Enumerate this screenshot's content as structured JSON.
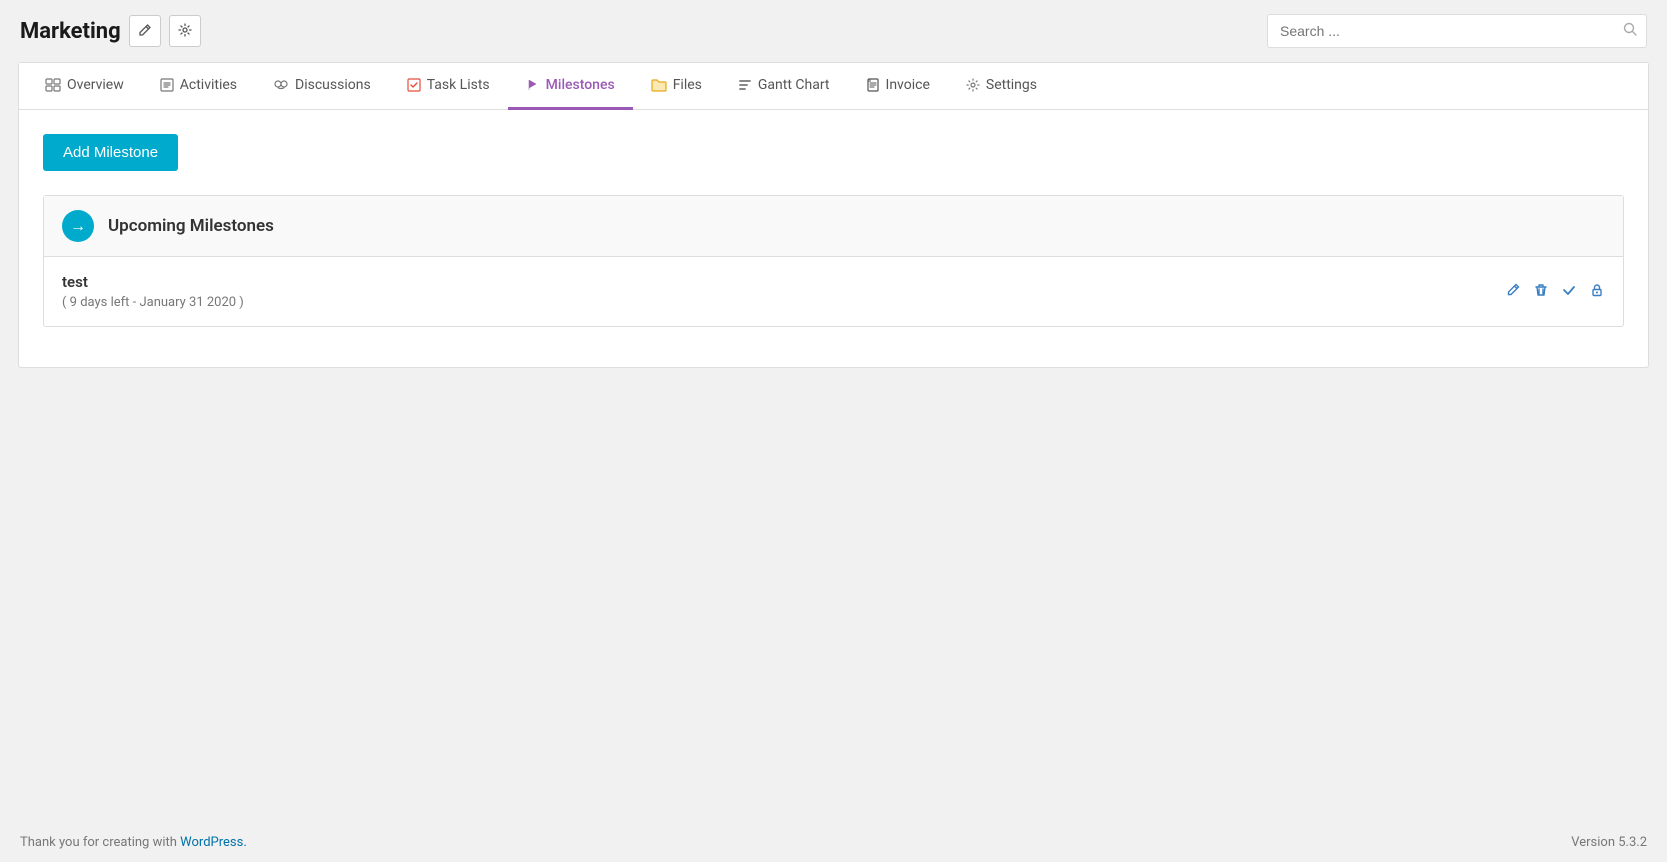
{
  "header": {
    "title": "Marketing",
    "edit_btn_label": "✏",
    "settings_btn_label": "⚙",
    "search_placeholder": "Search ..."
  },
  "tabs": [
    {
      "id": "overview",
      "label": "Overview",
      "icon": "🖥",
      "active": false
    },
    {
      "id": "activities",
      "label": "Activities",
      "icon": "📋",
      "active": false
    },
    {
      "id": "discussions",
      "label": "Discussions",
      "icon": "👥",
      "active": false
    },
    {
      "id": "task-lists",
      "label": "Task Lists",
      "icon": "✅",
      "active": false
    },
    {
      "id": "milestones",
      "label": "Milestones",
      "icon": "🚩",
      "active": true
    },
    {
      "id": "files",
      "label": "Files",
      "icon": "📁",
      "active": false
    },
    {
      "id": "gantt-chart",
      "label": "Gantt Chart",
      "icon": "≡",
      "active": false
    },
    {
      "id": "invoice",
      "label": "Invoice",
      "icon": "📄",
      "active": false
    },
    {
      "id": "settings",
      "label": "Settings",
      "icon": "⚙",
      "active": false
    }
  ],
  "add_milestone_label": "Add Milestone",
  "upcoming_milestones": {
    "section_title": "Upcoming Milestones",
    "arrow_icon": "→",
    "items": [
      {
        "name": "test",
        "date_label": "( 9 days left - January 31 2020 )"
      }
    ]
  },
  "footer": {
    "thank_you_text": "Thank you for creating with ",
    "wordpress_label": "WordPress.",
    "version_label": "Version 5.3.2"
  }
}
